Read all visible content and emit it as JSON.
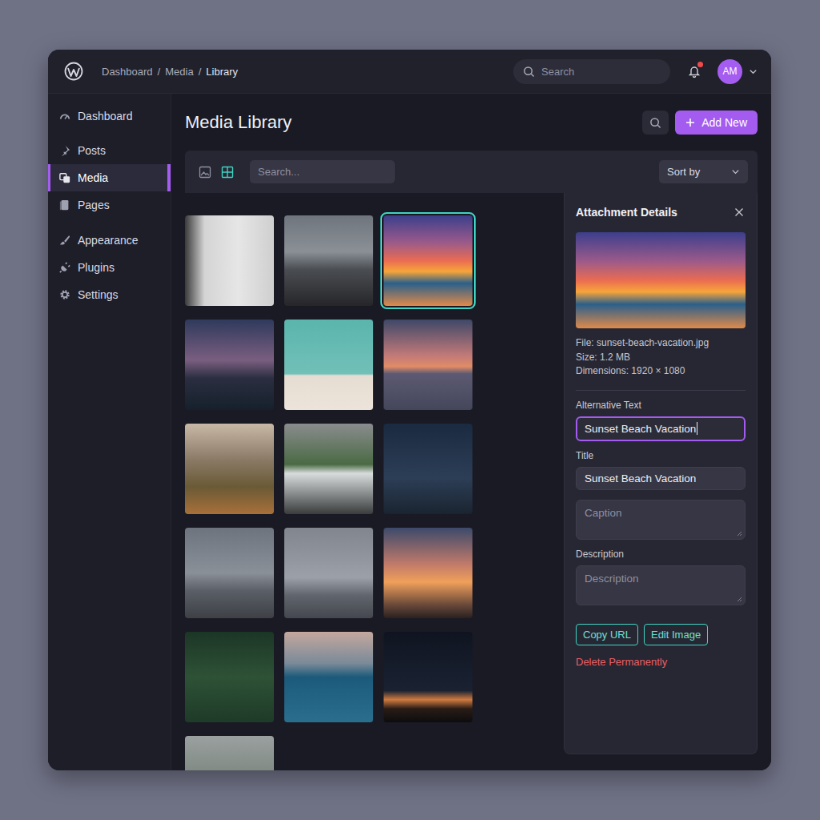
{
  "breadcrumb": {
    "items": [
      "Dashboard",
      "Media",
      "Library"
    ],
    "separator": "/"
  },
  "topbar": {
    "search_placeholder": "Search",
    "notifications": {
      "unread": true
    },
    "user": {
      "initials": "AM"
    }
  },
  "sidebar": {
    "groups": [
      {
        "items": [
          {
            "label": "Dashboard",
            "selected": false
          }
        ]
      },
      {
        "items": [
          {
            "label": "Posts",
            "selected": false
          },
          {
            "label": "Media",
            "selected": true
          },
          {
            "label": "Pages",
            "selected": false
          }
        ]
      },
      {
        "items": [
          {
            "label": "Appearance",
            "selected": false
          },
          {
            "label": "Plugins",
            "selected": false
          },
          {
            "label": "Settings",
            "selected": false
          }
        ]
      }
    ]
  },
  "page": {
    "title": "Media Library",
    "add_button": "Add New"
  },
  "toolbar": {
    "views": [
      {
        "selected": false
      },
      {
        "selected": true
      }
    ],
    "search_placeholder": "Search...",
    "sort_label": "Sort by"
  },
  "media": [
    {
      "selected": false
    },
    {
      "selected": false
    },
    {
      "selected": true
    },
    {
      "selected": false
    },
    {
      "selected": false
    },
    {
      "selected": false
    },
    {
      "selected": false
    },
    {
      "selected": false
    },
    {
      "selected": false
    },
    {
      "selected": false
    },
    {
      "selected": false
    },
    {
      "selected": false
    },
    {
      "selected": false
    },
    {
      "selected": false
    },
    {
      "selected": false
    },
    {
      "selected": false
    }
  ],
  "details": {
    "title": "Attachment Details",
    "info": [
      "File: sunset-beach-vacation.jpg",
      "Size: 1.2 MB",
      "Dimensions: 1920 × 1080"
    ],
    "fields": [
      {
        "label": "Alternative Text",
        "value": "Sunset Beach Vacation",
        "focused": true,
        "kind": "input"
      },
      {
        "label": "Title",
        "value": "Sunset Beach Vacation",
        "focused": false,
        "kind": "input"
      },
      {
        "placeholder": "Caption",
        "focused": false,
        "kind": "textarea"
      },
      {
        "label": "Description",
        "placeholder": "Description",
        "focused": false,
        "kind": "textarea"
      }
    ],
    "buttons": [
      "Copy URL",
      "Edit Image"
    ],
    "delete": "Delete Permanently"
  }
}
